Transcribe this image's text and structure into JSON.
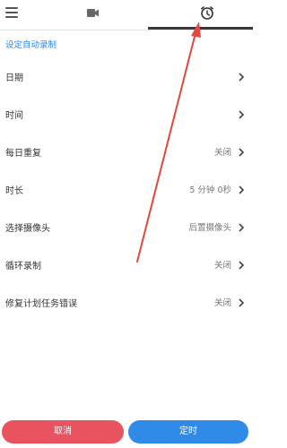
{
  "header": {
    "menu_icon": "menu-icon",
    "tabs": [
      {
        "icon": "video-camera-icon"
      },
      {
        "icon": "alarm-clock-icon",
        "active": true
      }
    ]
  },
  "section": {
    "title": "设定自动录制"
  },
  "rows": [
    {
      "label": "日期",
      "value": ""
    },
    {
      "label": "时间",
      "value": ""
    },
    {
      "label": "每日重复",
      "value": "关闭"
    },
    {
      "label": "时长",
      "value": "5 分钟 0秒"
    },
    {
      "label": "选择摄像头",
      "value": "后置摄像头"
    },
    {
      "label": "循环录制",
      "value": "关闭"
    },
    {
      "label": "修复计划任务错误",
      "value": "关闭"
    }
  ],
  "buttons": {
    "cancel": "取消",
    "confirm": "定时"
  },
  "colors": {
    "accent_blue": "#2f86e6",
    "cancel_red": "#e95360",
    "annotation_arrow": "#e8453c"
  }
}
